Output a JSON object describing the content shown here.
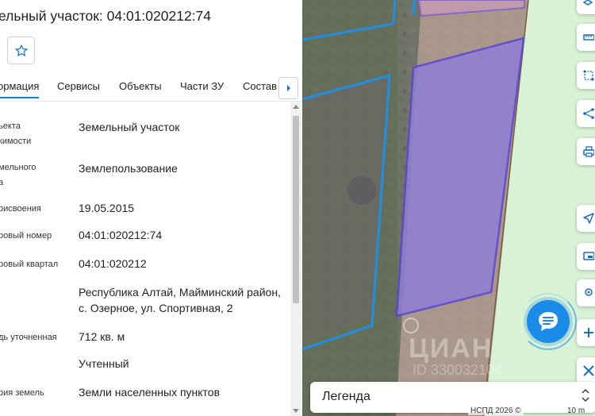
{
  "header": {
    "title": "ельный участок: 04:01:020212:74"
  },
  "favorite": {
    "icon": "star-icon"
  },
  "tabs": [
    {
      "label": "ормация",
      "active": true
    },
    {
      "label": "Сервисы",
      "active": false
    },
    {
      "label": "Объекты",
      "active": false
    },
    {
      "label": "Части ЗУ",
      "active": false
    },
    {
      "label": "Состав",
      "active": false
    }
  ],
  "attributes": [
    {
      "label": "ьекта\nкимости",
      "value": "Земельный участок"
    },
    {
      "label": "мельного\nа",
      "value": "Землепользование"
    },
    {
      "label": "рисвоения",
      "value": "19.05.2015"
    },
    {
      "label": "ровый номер",
      "value": "04:01:020212:74"
    },
    {
      "label": "ровый квартал",
      "value": "04:01:020212"
    },
    {
      "label": "",
      "value": "Республика Алтай, Майминский район, с. Озерное, ул. Спортивная, 2"
    },
    {
      "label": "дь уточненная",
      "value": "712 кв. м"
    },
    {
      "label": "",
      "value": "Учтенный"
    },
    {
      "label": "рия земель",
      "value": "Земли населенных пунктов"
    }
  ],
  "map": {
    "legend_label": "Легенда",
    "attribution": "НСПД 2026 ©",
    "scale": "10 m",
    "watermark": "ЦИАН",
    "watermark_id": "ID 330032104",
    "selected_parcel_color": "#8f7fd4",
    "parcel_border_color": "#1f8fe6",
    "zone_color": "#d8f2d6"
  },
  "toolbar": {
    "icons": [
      "ruler-icon",
      "area-measure-icon",
      "share-icon",
      "print-icon",
      "locate-icon",
      "screen-icon",
      "pin-icon",
      "zoom-in-icon",
      "zoom-out-icon"
    ]
  }
}
